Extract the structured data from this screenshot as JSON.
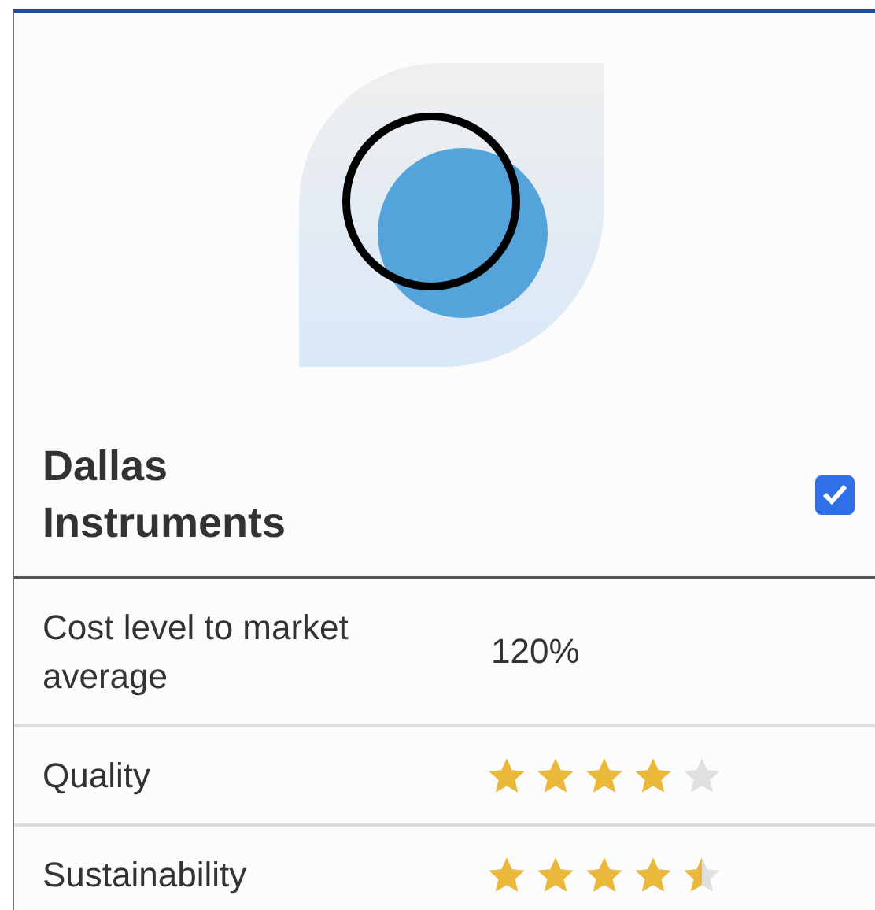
{
  "vendor": {
    "name": "Dallas Instruments",
    "selected": true
  },
  "rows": [
    {
      "kind": "text",
      "label": "Cost level to market average",
      "value": "120%"
    },
    {
      "kind": "rating",
      "label": "Quality",
      "stars": 4
    },
    {
      "kind": "rating",
      "label": "Sustainability",
      "stars": 4.5
    }
  ]
}
